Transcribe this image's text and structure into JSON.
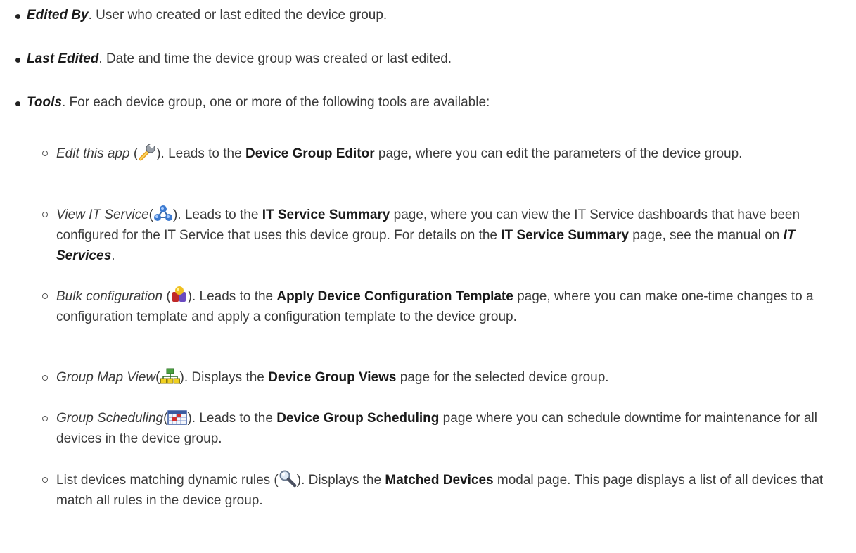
{
  "items": [
    {
      "term": "Edited By",
      "desc": ". User who created or last edited the device group."
    },
    {
      "term": "Last Edited",
      "desc": ". Date and time the device group was created or last edited."
    },
    {
      "term": "Tools",
      "desc": ". For each device group, one or more of the following tools are available:"
    }
  ],
  "tools": [
    {
      "name": "Edit this app",
      "pre": " (",
      "icon": "wrench-icon",
      "a": "). Leads to the ",
      "b1": "Device Group Editor",
      "c": " page, where you can edit the parameters of the device group."
    },
    {
      "name": "View IT Service",
      "pre": "(",
      "icon": "it-service-icon",
      "a": "). Leads to the ",
      "b1": "IT Service Summary",
      "c": " page, where you can view the IT Service dashboards that have been configured for the IT Service that uses this device group. For details on the ",
      "b2": "IT Service Summary",
      "d": " page, see the manual on ",
      "bi": "IT Services",
      "e": "."
    },
    {
      "name": "Bulk configuration",
      "pre": " (",
      "icon": "bulk-config-icon",
      "a": "). Leads to the ",
      "b1": "Apply Device Configuration Template",
      "c": " page, where you can make one-time changes to a configuration template and apply a configuration template to the device group."
    },
    {
      "name": "Group Map View",
      "pre": "(",
      "icon": "group-map-icon",
      "a": "). Displays the ",
      "b1": "Device Group Views",
      "c": " page for the selected device group."
    },
    {
      "name": "Group Scheduling",
      "pre": "(",
      "icon": "calendar-icon",
      "a": "). Leads to the ",
      "b1": "Device Group Scheduling",
      "c": " page where you can schedule downtime for maintenance for all devices in the device group."
    },
    {
      "name": "List devices matching dynamic rules",
      "pre": " (",
      "icon": "magnifier-icon",
      "a": "). Displays the ",
      "b1": "Matched Devices",
      "c": " modal page. This page displays a list of all devices that match all rules in the device group."
    }
  ]
}
